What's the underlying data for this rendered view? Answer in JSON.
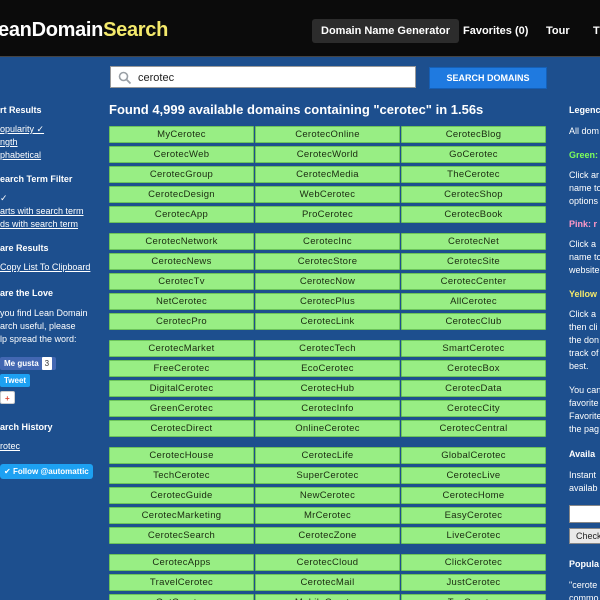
{
  "header": {
    "logo_part1": "eanDomain",
    "logo_part2": "Search",
    "nav": {
      "generator": "Domain Name Generator",
      "favorites": "Favorites (0)",
      "tour": "Tour",
      "more": "T"
    }
  },
  "sidebar": {
    "sort_heading": "rt Results",
    "sort_options": [
      "opularity ✓",
      "ngth",
      "phabetical"
    ],
    "filter_heading": "earch Term Filter",
    "filter_options": [
      "✓",
      "arts with search term",
      "ds with search term"
    ],
    "share_heading": "are Results",
    "copy_link": "Copy List To Clipboard",
    "love_heading": "are the Love",
    "love_text": [
      "you find Lean Domain",
      "arch useful, please",
      "lp spread the word:"
    ],
    "like_label": "Me gusta",
    "like_count": "3",
    "tweet_label": "Tweet",
    "gplus_label": "+",
    "history_heading": "arch History",
    "history_items": [
      "rotec"
    ],
    "follow_label": "Follow @automattic"
  },
  "search": {
    "value": "cerotec",
    "placeholder": "",
    "button_label": "SEARCH DOMAINS"
  },
  "results": {
    "title": "Found 4,999 available domains containing \"cerotec\" in 1.56s",
    "groups": [
      [
        [
          "MyCerotec",
          "CerotecOnline",
          "CerotecBlog"
        ],
        [
          "CerotecWeb",
          "CerotecWorld",
          "GoCerotec"
        ],
        [
          "CerotecGroup",
          "CerotecMedia",
          "TheCerotec"
        ],
        [
          "CerotecDesign",
          "WebCerotec",
          "CerotecShop"
        ],
        [
          "CerotecApp",
          "ProCerotec",
          "CerotecBook"
        ]
      ],
      [
        [
          "CerotecNetwork",
          "CerotecInc",
          "CerotecNet"
        ],
        [
          "CerotecNews",
          "CerotecStore",
          "CerotecSite"
        ],
        [
          "CerotecTv",
          "CerotecNow",
          "CerotecCenter"
        ],
        [
          "NetCerotec",
          "CerotecPlus",
          "AllCerotec"
        ],
        [
          "CerotecPro",
          "CerotecLink",
          "CerotecClub"
        ]
      ],
      [
        [
          "CerotecMarket",
          "CerotecTech",
          "SmartCerotec"
        ],
        [
          "FreeCerotec",
          "EcoCerotec",
          "CerotecBox"
        ],
        [
          "DigitalCerotec",
          "CerotecHub",
          "CerotecData"
        ],
        [
          "GreenCerotec",
          "CerotecInfo",
          "CerotecCity"
        ],
        [
          "CerotecDirect",
          "OnlineCerotec",
          "CerotecCentral"
        ]
      ],
      [
        [
          "CerotecHouse",
          "CerotecLife",
          "GlobalCerotec"
        ],
        [
          "TechCerotec",
          "SuperCerotec",
          "CerotecLive"
        ],
        [
          "CerotecGuide",
          "NewCerotec",
          "CerotecHome"
        ],
        [
          "CerotecMarketing",
          "MrCerotec",
          "EasyCerotec"
        ],
        [
          "CerotecSearch",
          "CerotecZone",
          "LiveCerotec"
        ]
      ],
      [
        [
          "CerotecApps",
          "CerotecCloud",
          "ClickCerotec"
        ],
        [
          "TravelCerotec",
          "CerotecMail",
          "JustCerotec"
        ],
        [
          "GetCerotec",
          "MobileCerotec",
          "TopCerotec"
        ]
      ]
    ]
  },
  "right": {
    "legend_heading": "Legenc",
    "all_dom": "All dom",
    "green": "Green:",
    "green_text": [
      "Click ar",
      "name to",
      "options"
    ],
    "pink": "Pink: r",
    "pink_text": [
      "Click a",
      "name to",
      "website"
    ],
    "yellow": "Yellow",
    "yellow_text": [
      "Click a",
      "then cli",
      "the don",
      "track of",
      "best."
    ],
    "fav_text": [
      "You can",
      "favorite",
      "Favorite",
      "the pag"
    ],
    "avail_heading": "Availa",
    "avail_text": [
      "Instant",
      "availab"
    ],
    "check_label": "Check",
    "popular_heading": "Popula",
    "popular_text": [
      "\"cerote",
      "commo"
    ]
  }
}
